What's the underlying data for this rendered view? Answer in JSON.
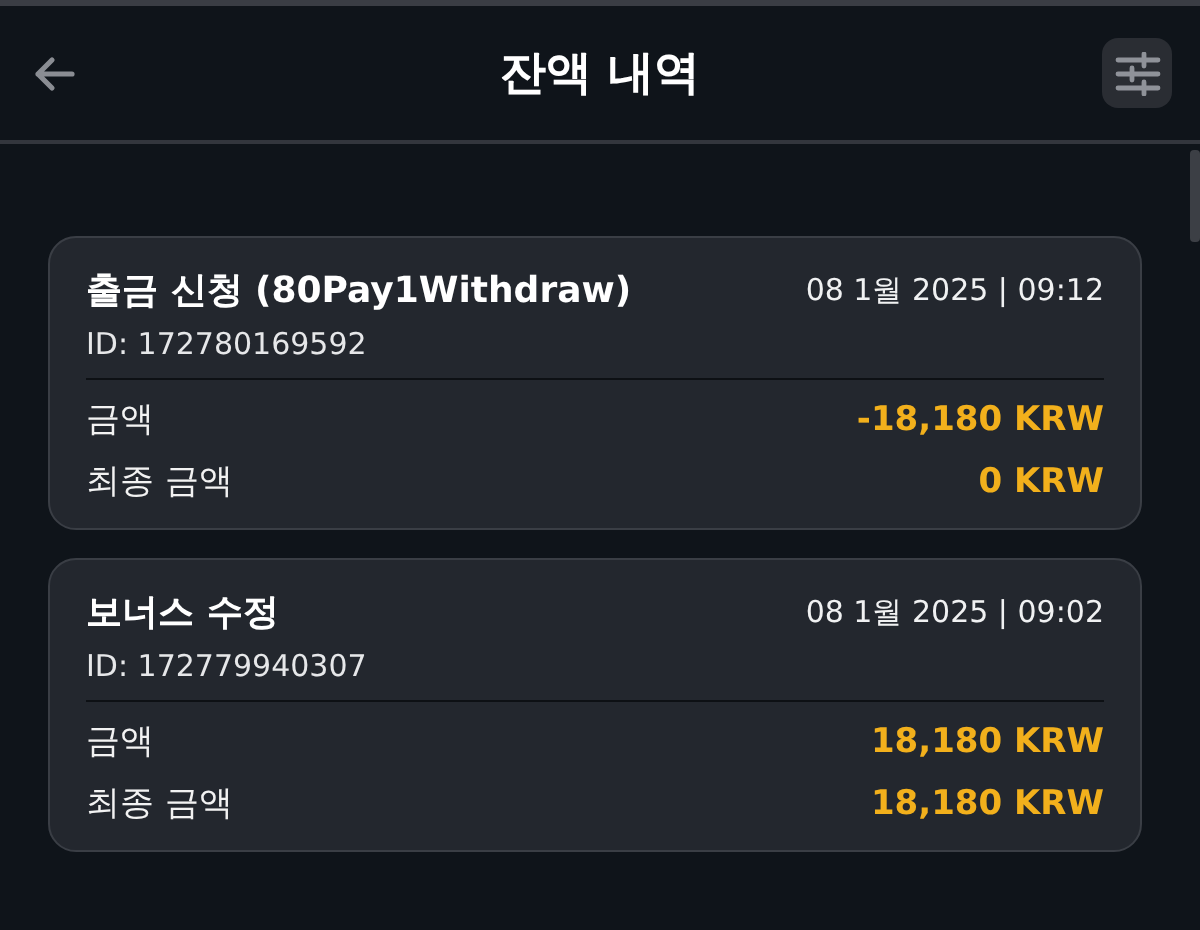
{
  "header": {
    "title": "잔액 내역"
  },
  "transactions": [
    {
      "title": "출금 신청 (80Pay1Withdraw)",
      "datetime": "08 1월 2025 | 09:12",
      "id": "ID: 172780169592",
      "rows": [
        {
          "label": "금액",
          "value": "-18,180 KRW"
        },
        {
          "label": "최종 금액",
          "value": "0 KRW"
        }
      ]
    },
    {
      "title": "보너스 수정",
      "datetime": "08 1월 2025 | 09:02",
      "id": "ID: 172779940307",
      "rows": [
        {
          "label": "금액",
          "value": "18,180 KRW"
        },
        {
          "label": "최종 금액",
          "value": "18,180 KRW"
        }
      ]
    }
  ]
}
